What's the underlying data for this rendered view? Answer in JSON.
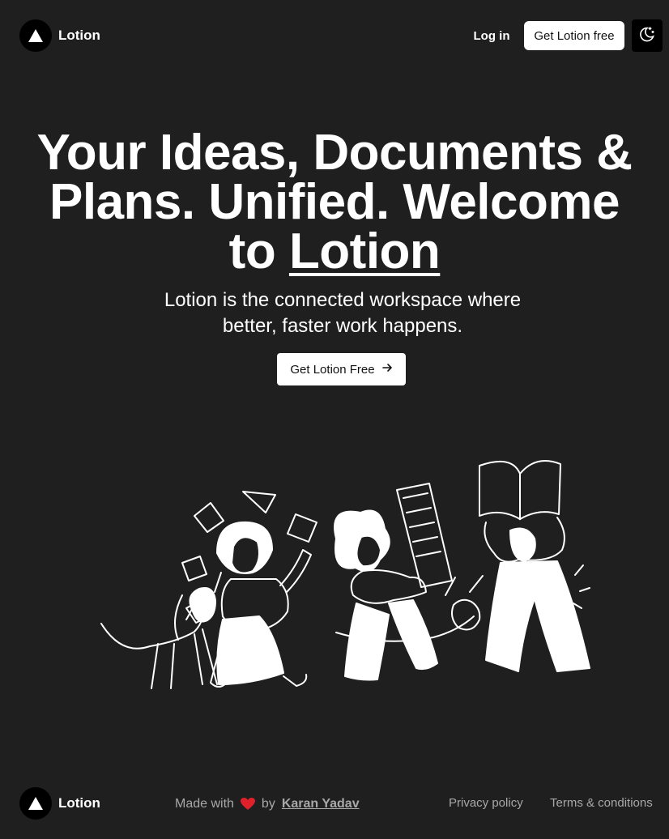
{
  "header": {
    "brand_name": "Lotion",
    "login_label": "Log in",
    "get_free_label": "Get Lotion free"
  },
  "hero": {
    "title_line1": "Your Ideas, Documents &",
    "title_line2": "Plans. Unified. Welcome",
    "title_to": "to",
    "title_brand": "Lotion",
    "subtitle_line1": "Lotion is the connected workspace where",
    "subtitle_line2": "better, faster work happens.",
    "cta_label": "Get Lotion Free"
  },
  "footer": {
    "brand_name": "Lotion",
    "made_with": "Made with",
    "by": "by",
    "author": "Karan Yadav",
    "privacy_label": "Privacy policy",
    "terms_label": "Terms & conditions"
  },
  "colors": {
    "background": "#1f1f1f",
    "logo_bg": "#000000",
    "button_bg": "#ffffff",
    "muted_text": "#a8a8a8",
    "heart": "#e0202a"
  },
  "icons": [
    "logo-triangle-icon",
    "moon-stars-icon",
    "arrow-right-icon",
    "heart-icon"
  ]
}
